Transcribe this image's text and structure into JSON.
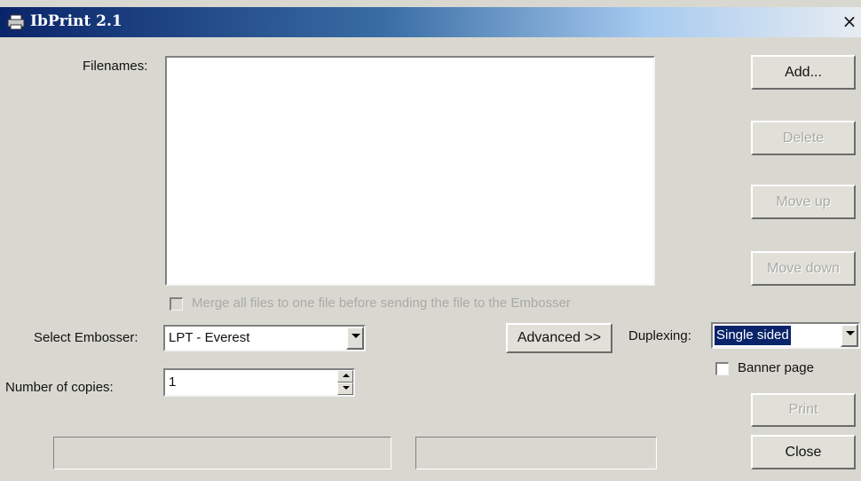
{
  "window": {
    "title": "IbPrint 2.1",
    "close_glyph": "×"
  },
  "filenames": {
    "label": "Filenames:",
    "items": []
  },
  "merge": {
    "label": "Merge all files to one file before sending the file to the Embosser",
    "checked": false,
    "enabled": false
  },
  "embosser": {
    "label": "Select Embosser:",
    "value": "LPT - Everest"
  },
  "copies": {
    "label": "Number of copies:",
    "value": "1"
  },
  "buttons": {
    "add": "Add...",
    "delete": "Delete",
    "move_up": "Move up",
    "move_down": "Move down",
    "advanced": "Advanced >>",
    "print": "Print",
    "close": "Close"
  },
  "duplexing": {
    "label": "Duplexing:",
    "value": "Single sided"
  },
  "banner": {
    "label": "Banner page",
    "checked": false
  },
  "colors": {
    "selection_bg": "#0a246a",
    "selection_fg": "#ffffff",
    "dialog_bg": "#d9d8d0"
  },
  "icons": {
    "title": "printer-icon",
    "close": "close-icon",
    "dropdown": "chevron-down-icon",
    "spin_up": "spin-up-icon",
    "spin_down": "spin-down-icon"
  }
}
